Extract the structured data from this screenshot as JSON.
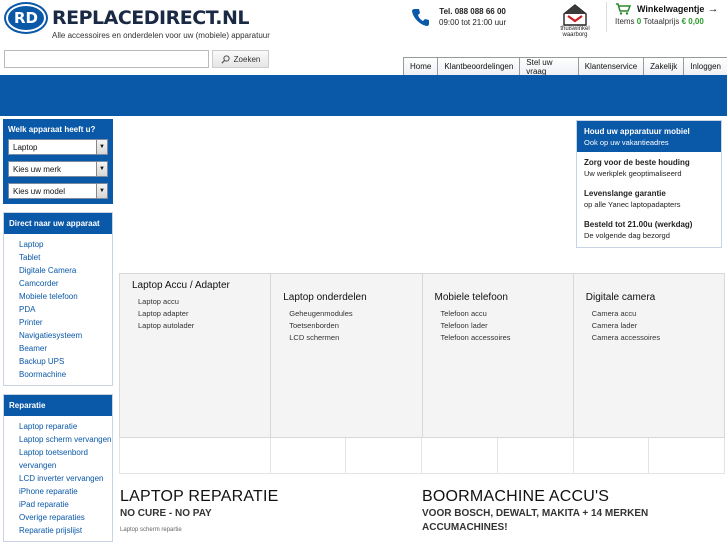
{
  "brand": {
    "logo_initials": "RD",
    "name_bold": "REPLACEDIRECT",
    "name_suffix": ".NL",
    "tagline": "Alle accessoires en onderdelen voor uw (mobiele) apparatuur"
  },
  "contact": {
    "phone": "Tel. 088 088 66 00",
    "hours": "09:00 tot 21:00 uur"
  },
  "trustmark": {
    "line1": "thuiswinkel",
    "line2": "waarborg"
  },
  "cart": {
    "title": "Winkelwagentje",
    "arrow": "→",
    "items_label": "Items",
    "items_count": "0",
    "total_label": "Totaalprijs",
    "total_value": "€ 0,00"
  },
  "search": {
    "placeholder": "",
    "button_label": "Zoeken"
  },
  "topnav": [
    "Home",
    "Klantbeoordelingen",
    "Stel uw vraag",
    "Klantenservice",
    "Zakelijk",
    "Inloggen"
  ],
  "device_selector": {
    "title": "Welk apparaat heeft u?",
    "selects": [
      "Laptop",
      "Kies uw merk",
      "Kies uw model"
    ]
  },
  "direct": {
    "title": "Direct naar uw apparaat",
    "items": [
      "Laptop",
      "Tablet",
      "Digitale Camera",
      "Camcorder",
      "Mobiele telefoon",
      "PDA",
      "Printer",
      "Navigatiesysteem",
      "Beamer",
      "Backup UPS",
      "Boormachine"
    ]
  },
  "repair": {
    "title": "Reparatie",
    "items": [
      "Laptop reparatie",
      "Laptop scherm vervangen",
      "Laptop toetsenbord vervangen",
      "LCD inverter vervangen",
      "iPhone reparatie",
      "iPad reparatie",
      "Overige reparaties",
      "Reparatie prijslijst"
    ]
  },
  "usps": [
    {
      "title": "Houd uw apparatuur mobiel",
      "text": "Ook op uw vakantieadres"
    },
    {
      "title": "Zorg voor de beste houding",
      "text": "Uw werkplek geoptimaliseerd"
    },
    {
      "title": "Levenslange garantie",
      "text": "op alle Yanec laptopadapters"
    },
    {
      "title": "Besteld tot 21.00u (werkdag)",
      "text": "De volgende dag bezorgd"
    }
  ],
  "categories": [
    {
      "title": "Laptop Accu / Adapter",
      "links": [
        "Laptop accu",
        "Laptop adapter",
        "Laptop autolader"
      ]
    },
    {
      "title": "Laptop onderdelen",
      "links": [
        "Geheugenmodules",
        "Toetsenborden",
        "LCD schermen"
      ]
    },
    {
      "title": "Mobiele telefoon",
      "links": [
        "Telefoon accu",
        "Telefoon lader",
        "Telefoon accessoires"
      ]
    },
    {
      "title": "Digitale camera",
      "links": [
        "Camera accu",
        "Camera lader",
        "Camera accessoires"
      ]
    }
  ],
  "promos": [
    {
      "title": "LAPTOP REPARATIE",
      "subtitle": "NO CURE - NO PAY",
      "line": "Laptop scherm repartie"
    },
    {
      "title": "BOORMACHINE ACCU'S",
      "subtitle": "VOOR BOSCH, DEWALT, MAKITA + 14 MERKEN ACCUMACHINES!",
      "line": ""
    }
  ],
  "colors": {
    "brand_blue": "#0a58a8",
    "price_green": "#2a9a2a"
  }
}
